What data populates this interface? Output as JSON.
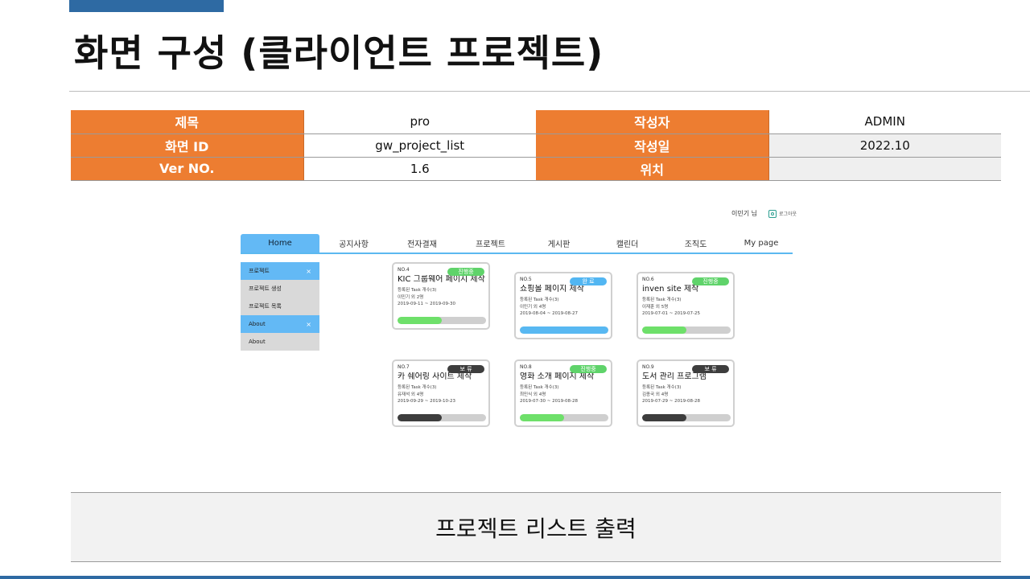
{
  "slide": {
    "title": "화면 구성 (클라이언트 프로젝트)"
  },
  "info": {
    "rows": [
      [
        {
          "label": "제목"
        },
        {
          "value": "pro"
        },
        {
          "label": "작성자"
        },
        {
          "value": "ADMIN"
        }
      ],
      [
        {
          "label": "화면 ID"
        },
        {
          "value": "gw_project_list"
        },
        {
          "label": "작성일"
        },
        {
          "value": "2022.10"
        }
      ],
      [
        {
          "label": "Ver NO."
        },
        {
          "value": "1.6"
        },
        {
          "label": "위치"
        },
        {
          "value": ""
        }
      ]
    ]
  },
  "mockup": {
    "user": "이민기 님",
    "logout": "로그아웃",
    "nav": [
      "Home",
      "공지사항",
      "전자결재",
      "프로젝트",
      "게시판",
      "캘린더",
      "조직도",
      "My page"
    ],
    "active_nav": "Home",
    "sidebar": [
      {
        "label": "프로젝트",
        "close": "×",
        "group": true
      },
      {
        "label": "프로젝트 생성",
        "close": "",
        "group": false
      },
      {
        "label": "프로젝트 목록",
        "close": "",
        "group": false
      },
      {
        "label": "About",
        "close": "×",
        "group": true
      },
      {
        "label": "About",
        "close": "",
        "group": false
      }
    ],
    "cards": [
      {
        "no": "NO.4",
        "status": "진행중",
        "status_color": "#5fd36a",
        "title": "KIC 그룹웨어 페이지 제작",
        "tasks": "등록된 Task 개수(3)",
        "members": "이민기 외 2명",
        "period": "2019-09-11 ~ 2019-09-30",
        "progress": 0.5,
        "bar_color": "#6ee06a"
      },
      {
        "no": "NO.5",
        "status": "완 료",
        "status_color": "#52b6f2",
        "title": "쇼핑몰 페이지 제작",
        "tasks": "등록된 Task 개수(3)",
        "members": "이민기 외 4명",
        "period": "2019-08-04 ~ 2019-08-27",
        "progress": 1.0,
        "bar_color": "#58b8f2"
      },
      {
        "no": "NO.6",
        "status": "진행중",
        "status_color": "#5fd36a",
        "title": "inven site 제작",
        "tasks": "등록된 Task 개수(3)",
        "members": "이재훈 외 5명",
        "period": "2019-07-01 ~ 2019-07-25",
        "progress": 0.5,
        "bar_color": "#6ee06a"
      },
      {
        "no": "NO.7",
        "status": "보 류",
        "status_color": "#3d3d3d",
        "title": "카 쉐어링 사이트 제작",
        "tasks": "등록된 Task 개수(3)",
        "members": "유재석 외 4명",
        "period": "2019-09-29 ~ 2019-10-23",
        "progress": 0.5,
        "bar_color": "#3d3d3d"
      },
      {
        "no": "NO.8",
        "status": "진행중",
        "status_color": "#5fd36a",
        "title": "영화 소개 페이지 제작",
        "tasks": "등록된 Task 개수(3)",
        "members": "최민식 외 4명",
        "period": "2019-07-30 ~ 2019-08-28",
        "progress": 0.5,
        "bar_color": "#6ee06a"
      },
      {
        "no": "NO.9",
        "status": "보 류",
        "status_color": "#3d3d3d",
        "title": "도서 관리 프로그램",
        "tasks": "등록된 Task 개수(3)",
        "members": "김종국 외 4명",
        "period": "2019-07-29 ~ 2019-08-28",
        "progress": 0.5,
        "bar_color": "#3d3d3d"
      }
    ]
  },
  "description": "프로젝트 리스트 출력",
  "colors": {
    "header_orange": "#ed7d31",
    "accent_blue": "#2e6aa3",
    "nav_blue": "#63b9f5"
  }
}
